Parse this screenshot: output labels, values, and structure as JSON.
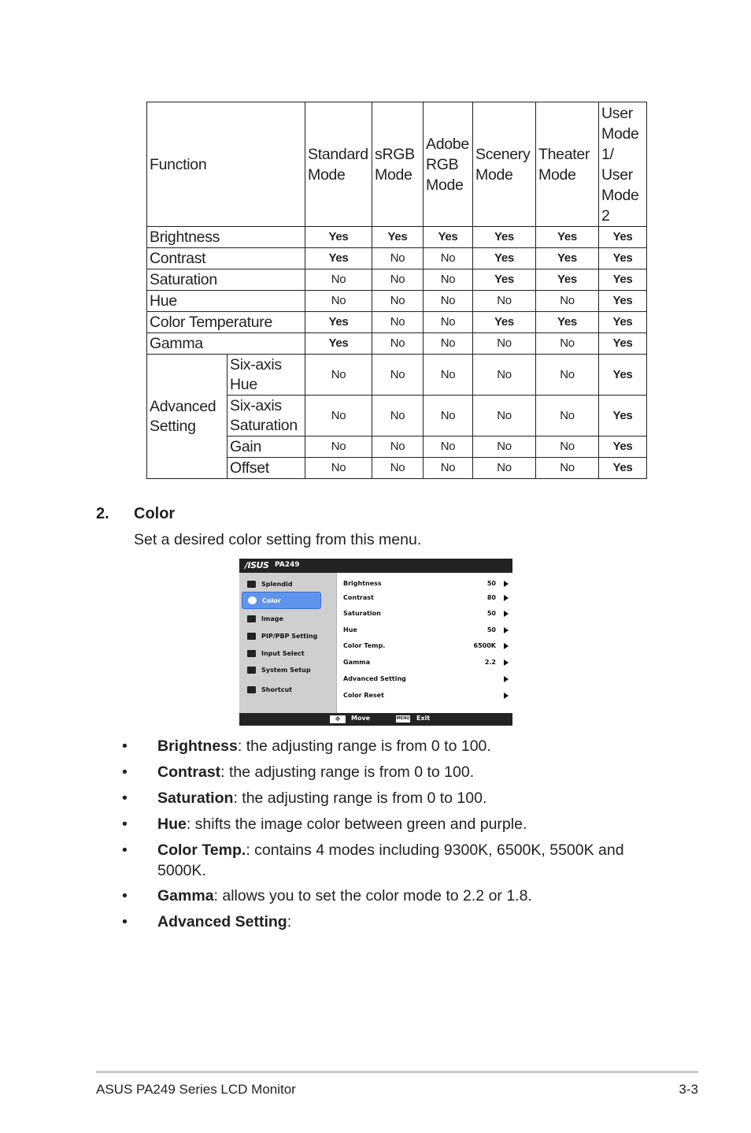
{
  "table": {
    "header": {
      "function": "Function",
      "modes": [
        "Standard Mode",
        "sRGB Mode",
        "Adobe RGB Mode",
        "Scenery Mode",
        "Theater Mode",
        "User Mode 1/ User Mode 2"
      ]
    },
    "rows": [
      {
        "function": "Brightness",
        "values": [
          "Yes",
          "Yes",
          "Yes",
          "Yes",
          "Yes",
          "Yes"
        ]
      },
      {
        "function": "Contrast",
        "values": [
          "Yes",
          "No",
          "No",
          "Yes",
          "Yes",
          "Yes"
        ]
      },
      {
        "function": "Saturation",
        "values": [
          "No",
          "No",
          "No",
          "Yes",
          "Yes",
          "Yes"
        ]
      },
      {
        "function": "Hue",
        "values": [
          "No",
          "No",
          "No",
          "No",
          "No",
          "Yes"
        ]
      },
      {
        "function": "Color Temperature",
        "values": [
          "Yes",
          "No",
          "No",
          "Yes",
          "Yes",
          "Yes"
        ]
      },
      {
        "function": "Gamma",
        "values": [
          "Yes",
          "No",
          "No",
          "No",
          "No",
          "Yes"
        ]
      }
    ],
    "advanced": {
      "group": "Advanced Setting",
      "rows": [
        {
          "function": "Six-axis Hue",
          "values": [
            "No",
            "No",
            "No",
            "No",
            "No",
            "Yes"
          ]
        },
        {
          "function": "Six-axis Saturation",
          "values": [
            "No",
            "No",
            "No",
            "No",
            "No",
            "Yes"
          ]
        },
        {
          "function": "Gain",
          "values": [
            "No",
            "No",
            "No",
            "No",
            "No",
            "Yes"
          ]
        },
        {
          "function": "Offset",
          "values": [
            "No",
            "No",
            "No",
            "No",
            "No",
            "Yes"
          ]
        }
      ]
    }
  },
  "section": {
    "number": "2.",
    "title": "Color",
    "description": "Set a desired color setting from this menu."
  },
  "osd": {
    "brand": "/ISUS",
    "model": "PA249",
    "accent_color": "#5f93ec",
    "menu": [
      {
        "label": "Splendid",
        "icon": "splendid-icon",
        "active": false
      },
      {
        "label": "Color",
        "icon": "palette-icon",
        "active": true
      },
      {
        "label": "Image",
        "icon": "image-icon",
        "active": false
      },
      {
        "label": "PIP/PBP Setting",
        "icon": "pip-icon",
        "active": false
      },
      {
        "label": "Input Select",
        "icon": "input-icon",
        "active": false
      },
      {
        "label": "System Setup",
        "icon": "wrench-icon",
        "active": false
      },
      {
        "label": "Shortcut",
        "icon": "shortcut-icon",
        "active": false
      }
    ],
    "options": [
      {
        "label": "Brightness",
        "value": "50"
      },
      {
        "label": "Contrast",
        "value": "80"
      },
      {
        "label": "Saturation",
        "value": "50"
      },
      {
        "label": "Hue",
        "value": "50"
      },
      {
        "label": "Color Temp.",
        "value": "6500K"
      },
      {
        "label": "Gamma",
        "value": "2.2"
      },
      {
        "label": "Advanced Setting",
        "value": ""
      },
      {
        "label": "Color Reset",
        "value": ""
      }
    ],
    "footer": {
      "move_key": "✥",
      "move_label": "Move",
      "exit_key": "MENU",
      "exit_label": "Exit"
    }
  },
  "bullets": [
    {
      "term": "Brightness",
      "text": ": the adjusting range is from 0 to 100."
    },
    {
      "term": "Contrast",
      "text": ": the adjusting range is from 0 to 100."
    },
    {
      "term": "Saturation",
      "text": ": the adjusting range is from 0 to 100."
    },
    {
      "term": "Hue",
      "text": ": shifts the image color between green and purple."
    },
    {
      "term": "Color Temp.",
      "text": ": contains 4 modes including 9300K, 6500K, 5500K and 5000K."
    },
    {
      "term": "Gamma",
      "text": ": allows you to set the color mode to 2.2 or 1.8."
    },
    {
      "term": "Advanced Setting",
      "text": ":"
    }
  ],
  "bullet_glyph": "•",
  "footer": {
    "title": "ASUS PA249 Series LCD Monitor",
    "page": "3-3"
  }
}
